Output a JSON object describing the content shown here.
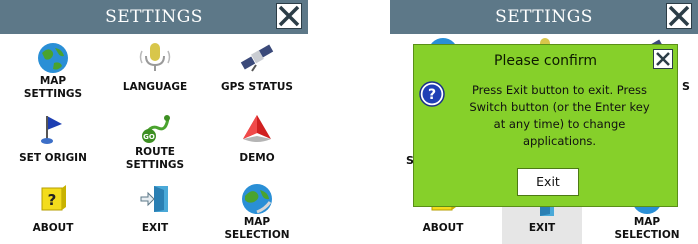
{
  "left_screen": {
    "title": "SETTINGS",
    "items": [
      {
        "label_lines": [
          "MAP",
          "SETTINGS"
        ],
        "icon": "globe-icon"
      },
      {
        "label_lines": [
          "LANGUAGE"
        ],
        "icon": "microphone-icon"
      },
      {
        "label_lines": [
          "GPS STATUS"
        ],
        "icon": "satellite-icon"
      },
      {
        "label_lines": [
          "SET ORIGIN"
        ],
        "icon": "flag-icon"
      },
      {
        "label_lines": [
          "ROUTE",
          "SETTINGS"
        ],
        "icon": "route-icon"
      },
      {
        "label_lines": [
          "DEMO"
        ],
        "icon": "arrow-logo-icon"
      },
      {
        "label_lines": [
          "ABOUT"
        ],
        "icon": "question-box-icon"
      },
      {
        "label_lines": [
          "EXIT"
        ],
        "icon": "exit-door-icon"
      },
      {
        "label_lines": [
          "MAP",
          "SELECTION"
        ],
        "icon": "globe-map-icon"
      }
    ]
  },
  "right_screen": {
    "title": "SETTINGS",
    "partial_letters": {
      "left": "S",
      "right": "S"
    },
    "items_visible": [
      {
        "label_lines": [
          "ABOUT"
        ]
      },
      {
        "label_lines": [
          "EXIT"
        ]
      },
      {
        "label_lines": [
          "MAP",
          "SELECTION"
        ]
      }
    ],
    "dialog": {
      "title": "Please confirm",
      "message_lines": [
        "Press Exit button to exit. Press",
        "Switch button (or the Enter key",
        "at any time) to change",
        "applications."
      ],
      "exit_label": "Exit"
    }
  },
  "colors": {
    "titlebar": "#5d7888",
    "dialog": "#86d02a",
    "pressed": "#e6e6e6"
  }
}
